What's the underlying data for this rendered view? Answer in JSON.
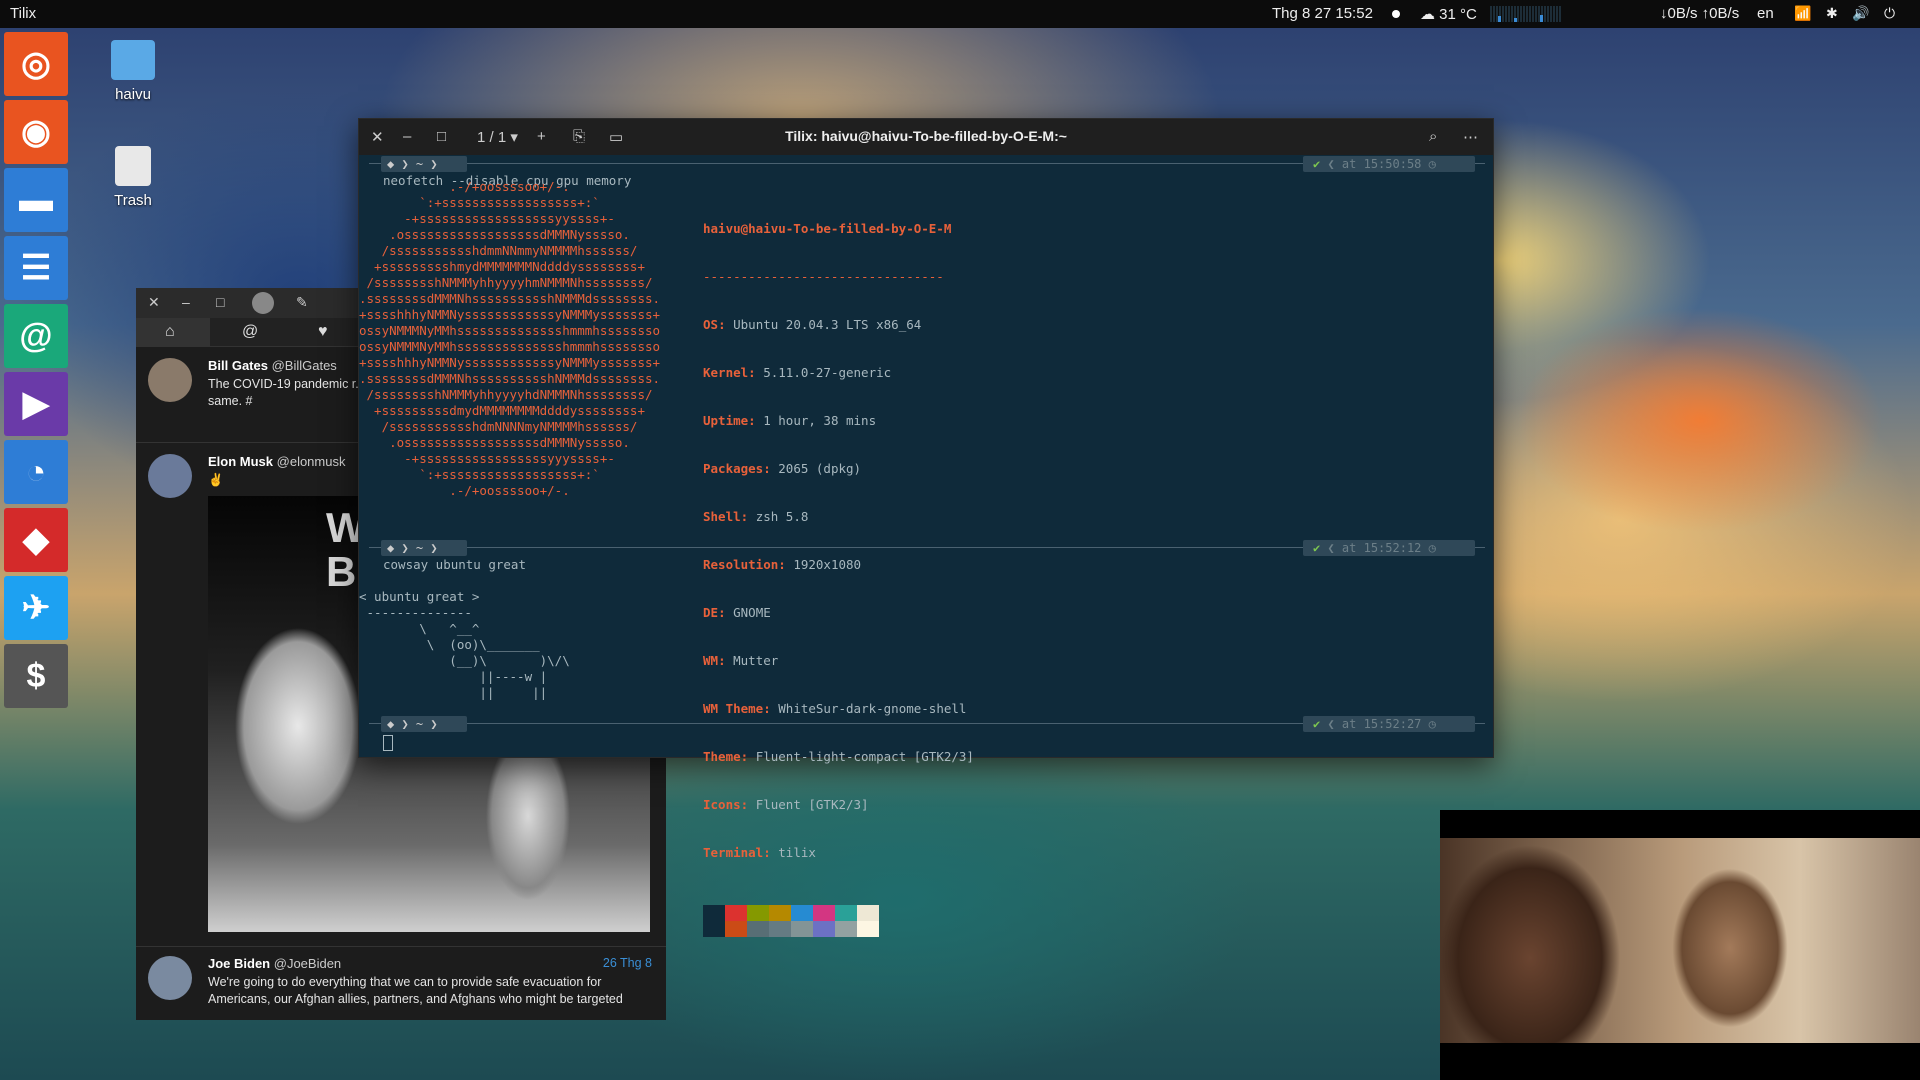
{
  "topbar": {
    "app_name": "Tilix",
    "datetime": "Thg 8 27  15:52",
    "weather": "31 °C",
    "weather_icon": "cloud-icon",
    "net_speed": "↓0B/s ↑0B/s",
    "language": "en",
    "status_icons": [
      "wifi-icon",
      "bluetooth-icon",
      "volume-icon",
      "power-icon"
    ]
  },
  "dock": {
    "items": [
      {
        "name": "ubuntu-software",
        "icon": "ubuntu-icon",
        "color": "#e95420"
      },
      {
        "name": "chrome",
        "icon": "chrome-icon",
        "color": "#e95420"
      },
      {
        "name": "files",
        "icon": "files-icon",
        "color": "#2e7dd6"
      },
      {
        "name": "news",
        "icon": "news-icon",
        "color": "#2e7dd6"
      },
      {
        "name": "mail",
        "icon": "mail-icon",
        "color": "#1aa87a"
      },
      {
        "name": "media-player",
        "icon": "play-icon",
        "color": "#6a3aa8"
      },
      {
        "name": "system-monitor",
        "icon": "gauge-icon",
        "color": "#2e7dd6"
      },
      {
        "name": "anydesk",
        "icon": "anydesk-icon",
        "color": "#d42a2a"
      },
      {
        "name": "twitter",
        "icon": "twitter-icon",
        "color": "#1da1f2"
      },
      {
        "name": "terminal",
        "icon": "terminal-icon",
        "color": "#555555"
      }
    ]
  },
  "desktop": {
    "home_label": "haivu",
    "trash_label": "Trash"
  },
  "terminal": {
    "title": "Tilix: haivu@haivu-To-be-filled-by-O-E-M:~",
    "session_counter": "1 / 1",
    "prompts": [
      {
        "command": "neofetch --disable cpu gpu memory",
        "time": "at 15:50:58"
      },
      {
        "command": "cowsay ubuntu great",
        "time": "at 15:52:12"
      },
      {
        "command": "",
        "time": "at 15:52:27"
      }
    ],
    "neofetch_art": "            .-/+oossssoo+/-.\n        `:+ssssssssssssssssss+:`\n      -+ssssssssssssssssssyyssss+-\n    .ossssssssssssssssssdMMMNysssso.\n   /ssssssssssshdmmNNmmyNMMMMhssssss/\n  +ssssssssshmydMMMMMMMNddddyssssssss+\n /sssssssshNMMMyhhyyyyhmNMMMNhssssssss/\n.ssssssssdMMMNhsssssssssshNMMMdssssssss.\n+sssshhhyNMMNyssssssssssssyNMMMysssssss+\nossyNMMMNyMMhsssssssssssssshmmmhssssssso\nossyNMMMNyMMhsssssssssssssshmmmhssssssso\n+sssshhhyNMMNyssssssssssssyNMMMysssssss+\n.ssssssssdMMMNhsssssssssshNMMMdssssssss.\n /sssssssshNMMMyhhyyyyhdNMMMNhssssssss/\n  +sssssssssdmydMMMMMMMMddddyssssssss+\n   /ssssssssssshdmNNNNmyNMMMMhssssss/\n    .ossssssssssssssssssdMMMNysssso.\n      -+sssssssssssssssssyyyssss+-\n        `:+ssssssssssssssssss+:`\n            .-/+oossssoo+/-.",
    "user_host": "haivu@haivu-To-be-filled-by-O-E-M",
    "separator": "--------------------------------",
    "info": [
      {
        "key": "OS",
        "value": "Ubuntu 20.04.3 LTS x86_64"
      },
      {
        "key": "Kernel",
        "value": "5.11.0-27-generic"
      },
      {
        "key": "Uptime",
        "value": "1 hour, 38 mins"
      },
      {
        "key": "Packages",
        "value": "2065 (dpkg)"
      },
      {
        "key": "Shell",
        "value": "zsh 5.8"
      },
      {
        "key": "Resolution",
        "value": "1920x1080"
      },
      {
        "key": "DE",
        "value": "GNOME"
      },
      {
        "key": "WM",
        "value": "Mutter"
      },
      {
        "key": "WM Theme",
        "value": "WhiteSur-dark-gnome-shell"
      },
      {
        "key": "Theme",
        "value": "Fluent-light-compact [GTK2/3]"
      },
      {
        "key": "Icons",
        "value": "Fluent [GTK2/3]"
      },
      {
        "key": "Terminal",
        "value": "tilix"
      }
    ],
    "palette_top": [
      "#0f2a3a",
      "#dc322f",
      "#859900",
      "#b58900",
      "#268bd2",
      "#d33682",
      "#2aa198",
      "#eee8d5"
    ],
    "palette_bottom": [
      "#0f2a3a",
      "#cb4b16",
      "#586e75",
      "#657b83",
      "#839496",
      "#6c71c4",
      "#93a1a1",
      "#fdf6e3"
    ],
    "cowsay_output": "< ubuntu great >\n --------------\n        \\   ^__^\n         \\  (oo)\\_______\n            (__)\\       )\\/\\\n                ||----w |\n                ||     ||"
  },
  "twitter": {
    "tweets": [
      {
        "name": "Bill Gates",
        "handle": "@BillGates",
        "text": "The COVID-19 pandemic r... Many of the building block... pandemic are the same. #",
        "date": ""
      },
      {
        "name": "Elon Musk",
        "handle": "@elonmusk",
        "text": "✌",
        "date": "",
        "photo_text": "W\nBE"
      },
      {
        "name": "Joe Biden",
        "handle": "@JoeBiden",
        "text": "We're going to do everything that we can to provide safe evacuation for Americans, our Afghan allies, partners, and Afghans who might be targeted",
        "date": "26 Thg 8"
      }
    ]
  }
}
